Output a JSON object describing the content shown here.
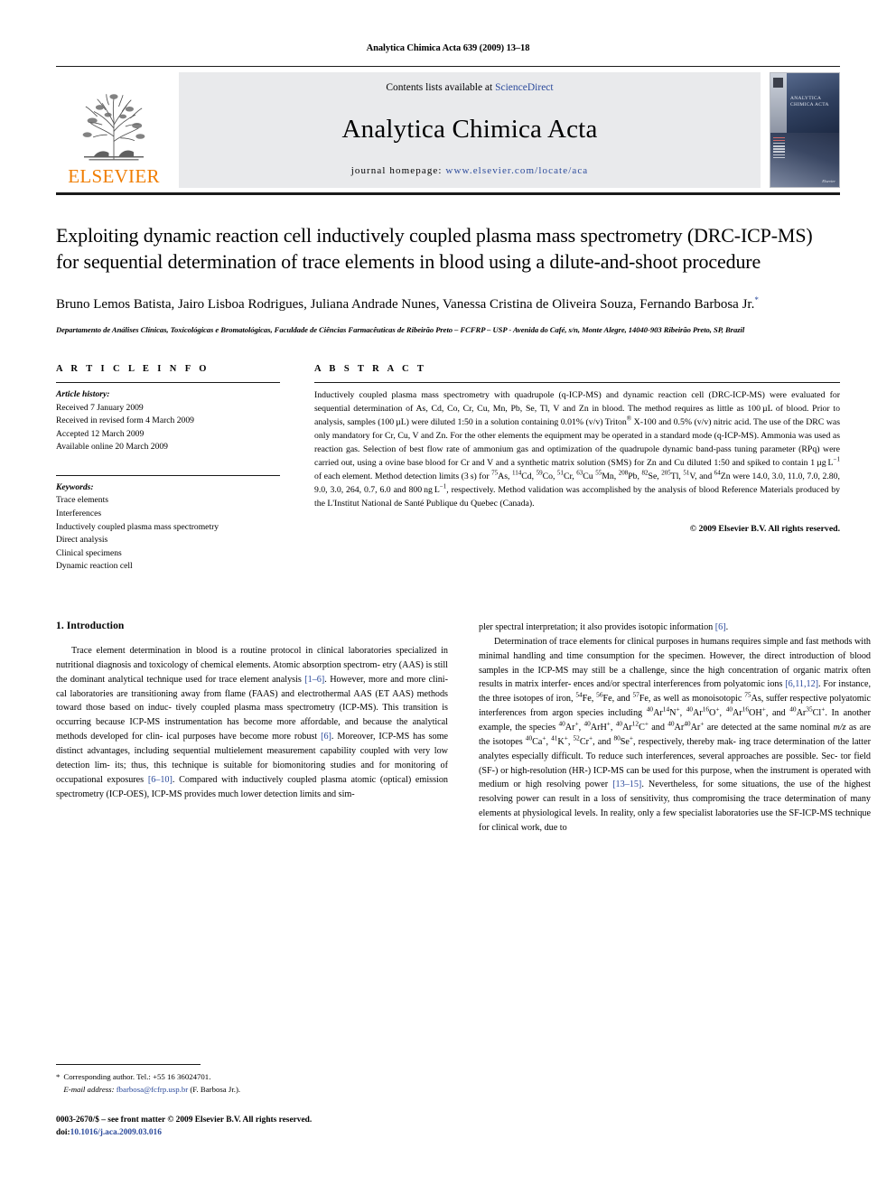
{
  "running_head": "Analytica Chimica Acta 639 (2009) 13–18",
  "masthead": {
    "publisher": "ELSEVIER",
    "contents_prefix": "Contents lists available at ",
    "sciencedirect": "ScienceDirect",
    "journal_title": "Analytica Chimica Acta",
    "homepage_label": "journal homepage:",
    "homepage_url": "www.elsevier.com/locate/aca",
    "cover_title_line1": "ANALYTICA",
    "cover_title_line2": "CHIMICA ACTA",
    "cover_signature": "Elsevier"
  },
  "article": {
    "title": "Exploiting dynamic reaction cell inductively coupled plasma mass spectrometry (DRC-ICP-MS) for sequential determination of trace elements in blood using a dilute-and-shoot procedure",
    "authors": "Bruno Lemos Batista, Jairo Lisboa Rodrigues, Juliana Andrade Nunes, Vanessa Cristina de Oliveira Souza, Fernando Barbosa Jr.",
    "corresponding_marker": "*",
    "affiliation": "Departamento de Análises Clínicas, Toxicológicas e Bromatológicas, Faculdade de Ciências Farmacêuticas de Ribeirão Preto – FCFRP – USP - Avenida do Café, s/n, Monte Alegre, 14040-903 Ribeirão Preto, SP, Brazil"
  },
  "info": {
    "heading": "A R T I C L E   I N F O",
    "history_label": "Article history:",
    "history": [
      "Received 7 January 2009",
      "Received in revised form 4 March 2009",
      "Accepted 12 March 2009",
      "Available online 20 March 2009"
    ],
    "keywords_label": "Keywords:",
    "keywords": [
      "Trace elements",
      "Interferences",
      "Inductively coupled plasma mass spectrometry",
      "Direct analysis",
      "Clinical specimens",
      "Dynamic reaction cell"
    ]
  },
  "abstract": {
    "heading": "A B S T R A C T",
    "copyright": "© 2009 Elsevier B.V. All rights reserved."
  },
  "introduction": {
    "heading": "1.  Introduction"
  },
  "footnote": {
    "star": "*",
    "corresponding": "Corresponding author. Tel.: +55 16 36024701.",
    "email_label": "E-mail address:",
    "email": "fbarbosa@fcfrp.usp.br",
    "email_person": "(F. Barbosa Jr.)."
  },
  "footer": {
    "issn_line": "0003-2670/$ – see front matter © 2009 Elsevier B.V. All rights reserved.",
    "doi_label": "doi:",
    "doi": "10.1016/j.aca.2009.03.016"
  },
  "colors": {
    "link_blue": "#2b4a9b",
    "elsevier_orange": "#f07d00",
    "banner_gray": "#e9eaec"
  }
}
